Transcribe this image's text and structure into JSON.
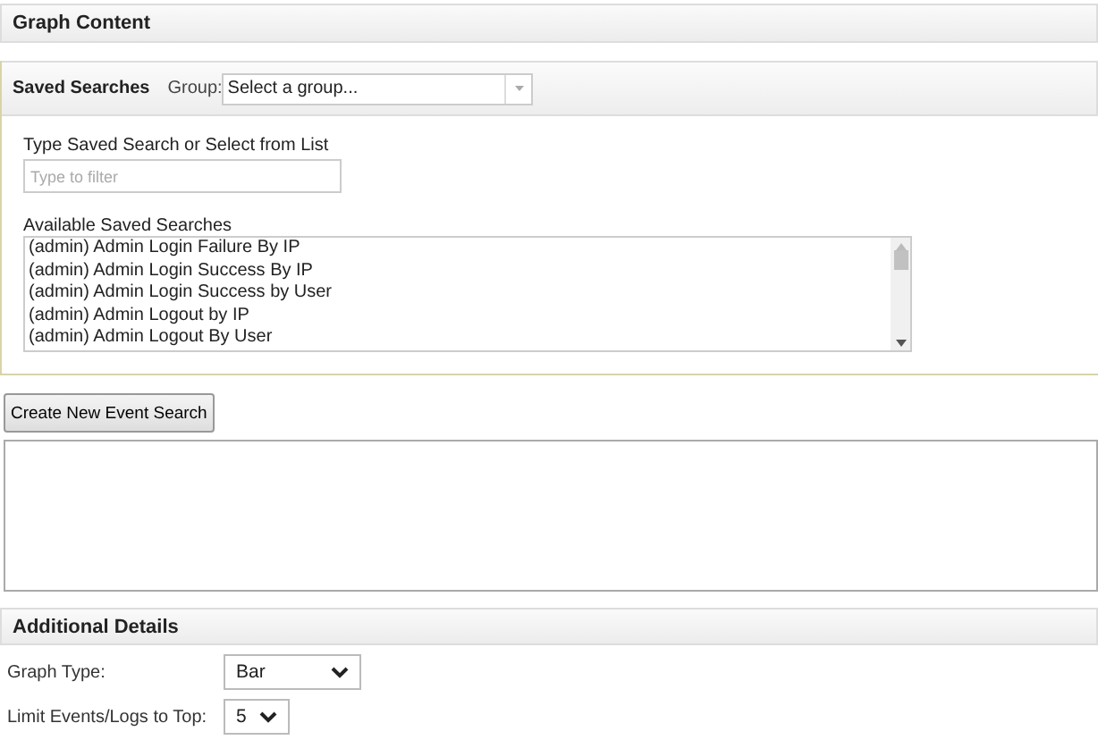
{
  "graph_content": {
    "title": "Graph Content"
  },
  "saved_searches": {
    "title": "Saved Searches",
    "group_label": "Group:",
    "group_value": "Select a group...",
    "filter_label": "Type Saved Search or Select from List",
    "filter_placeholder": "Type to filter",
    "list_label": "Available Saved Searches",
    "items": [
      {
        "label": "(admin) Admin Login Failure By IP",
        "selected": false
      },
      {
        "label": "(admin) Admin Login Success By IP",
        "selected": false
      },
      {
        "label": "(admin) Admin Login Success by User",
        "selected": false
      },
      {
        "label": "(admin) Admin Logout by IP",
        "selected": false
      },
      {
        "label": "(admin) Admin Logout By User",
        "selected": false
      }
    ]
  },
  "create_button": "Create New Event Search",
  "additional_details": {
    "title": "Additional Details",
    "fields": [
      {
        "label": "Graph Type:",
        "value": "Bar"
      },
      {
        "label": "Limit Events/Logs to Top:",
        "value": "5"
      }
    ]
  }
}
